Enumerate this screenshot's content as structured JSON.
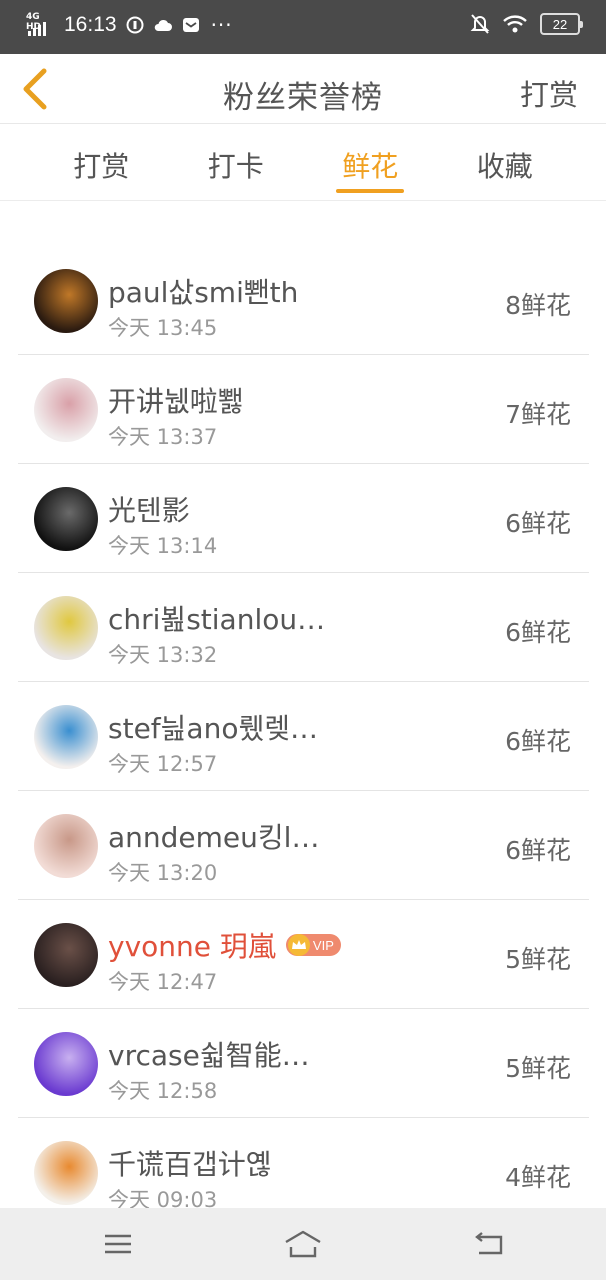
{
  "status_bar": {
    "network": "4G HD",
    "time": "16:13",
    "battery": "22"
  },
  "header": {
    "title": "粉丝荣誉榜",
    "action_label": "打赏"
  },
  "tabs": [
    {
      "label": "打赏",
      "active": false
    },
    {
      "label": "打卡",
      "active": false
    },
    {
      "label": "鲜花",
      "active": true
    },
    {
      "label": "收藏",
      "active": false
    }
  ],
  "vip_badge_label": "VIP",
  "fans": [
    {
      "name": "paul삾smi뽼th",
      "time": "今天 13:45",
      "count": "8鲜花",
      "vip": false,
      "avatar_colors": [
        "#2a1a10",
        "#c07828"
      ]
    },
    {
      "name": "开讲뉎啦뾇",
      "time": "今天 13:37",
      "count": "7鲜花",
      "vip": false,
      "avatar_colors": [
        "#f2eeee",
        "#d9a0a8"
      ]
    },
    {
      "name": "光텐影",
      "time": "今天 13:14",
      "count": "6鲜花",
      "vip": false,
      "avatar_colors": [
        "#111111",
        "#6a6a6a"
      ]
    },
    {
      "name": "chri뵖stianlou…",
      "time": "今天 13:32",
      "count": "6鲜花",
      "vip": false,
      "avatar_colors": [
        "#e8e4e2",
        "#e0c840"
      ]
    },
    {
      "name": "stef늺ano뤴렞…",
      "time": "今天 12:57",
      "count": "6鲜花",
      "vip": false,
      "avatar_colors": [
        "#f4f0ee",
        "#3a8fd0"
      ]
    },
    {
      "name": "anndemeu킹l…",
      "time": "今天 13:20",
      "count": "6鲜花",
      "vip": false,
      "avatar_colors": [
        "#f2dcd6",
        "#c89888"
      ]
    },
    {
      "name": "yvonne 玥嵐",
      "time": "今天 12:47",
      "count": "5鲜花",
      "vip": true,
      "avatar_colors": [
        "#2a2020",
        "#6a5048"
      ]
    },
    {
      "name": "vrcase쉷智能…",
      "time": "今天 12:58",
      "count": "5鲜花",
      "vip": false,
      "avatar_colors": [
        "#6a3ad0",
        "#c8b0f0"
      ]
    },
    {
      "name": "千谎百갭计옎",
      "time": "今天 09:03",
      "count": "4鲜花",
      "vip": false,
      "avatar_colors": [
        "#f4f0ea",
        "#e88a30"
      ]
    }
  ],
  "nav": {
    "menu_icon": "menu-icon",
    "home_icon": "home-icon",
    "back_icon": "back-icon"
  }
}
